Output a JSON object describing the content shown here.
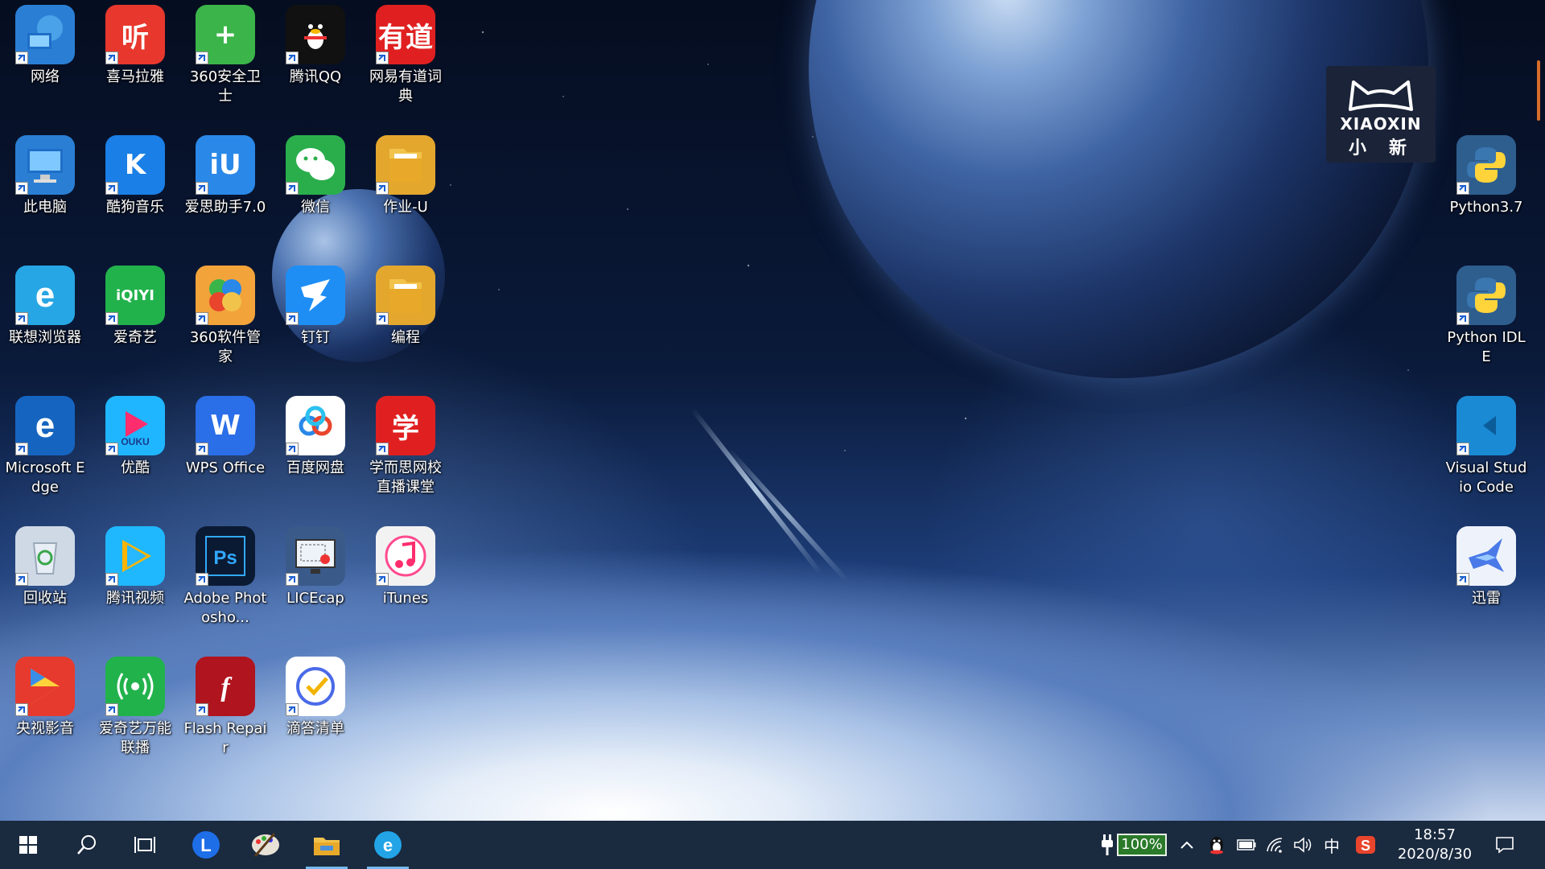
{
  "desktop": {
    "icons": [
      {
        "label": "网络",
        "color": "#2a7fd4",
        "glyph": "net"
      },
      {
        "label": "喜马拉雅",
        "color": "#e8382d",
        "glyph": "听"
      },
      {
        "label": "360安全卫士",
        "color": "#3bb54a",
        "glyph": "+"
      },
      {
        "label": "腾讯QQ",
        "color": "#111111",
        "glyph": "qq"
      },
      {
        "label": "网易有道词典",
        "color": "#e02020",
        "glyph": "有道"
      },
      {
        "label": "此电脑",
        "color": "#2a7fd4",
        "glyph": "pc"
      },
      {
        "label": "酷狗音乐",
        "color": "#1a7fe6",
        "glyph": "K"
      },
      {
        "label": "爱思助手7.0",
        "color": "#2a88e8",
        "glyph": "iU"
      },
      {
        "label": "微信",
        "color": "#2aae4c",
        "glyph": "wx"
      },
      {
        "label": "作业-U",
        "color": "#e3a72e",
        "glyph": "folder"
      },
      {
        "label": "联想浏览器",
        "color": "#26a6e4",
        "glyph": "e"
      },
      {
        "label": "爱奇艺",
        "color": "#22b24c",
        "glyph": "iQIYI"
      },
      {
        "label": "360软件管家",
        "color": "#f2a33a",
        "glyph": "flower"
      },
      {
        "label": "钉钉",
        "color": "#1e8ef5",
        "glyph": "dd"
      },
      {
        "label": "编程",
        "color": "#e3a72e",
        "glyph": "folder"
      },
      {
        "label": "Microsoft Edge",
        "color": "#1565c0",
        "glyph": "e"
      },
      {
        "label": "优酷",
        "color": "#1fb6ff",
        "glyph": "youku"
      },
      {
        "label": "WPS Office",
        "color": "#2a6ee8",
        "glyph": "W"
      },
      {
        "label": "百度网盘",
        "color": "#ffffff",
        "glyph": "bd"
      },
      {
        "label": "学而思网校直播课堂",
        "color": "#e02020",
        "glyph": "学"
      },
      {
        "label": "回收站",
        "color": "#cfd9e6",
        "glyph": "bin"
      },
      {
        "label": "腾讯视频",
        "color": "#1fb8ff",
        "glyph": "play"
      },
      {
        "label": "Adobe Photosho...",
        "color": "#0b1a33",
        "glyph": "Ps"
      },
      {
        "label": "LICEcap",
        "color": "#3a5a8a",
        "glyph": "rec"
      },
      {
        "label": "iTunes",
        "color": "#f2f2f2",
        "glyph": "note"
      },
      {
        "label": "央视影音",
        "color": "#e63a2e",
        "glyph": "cctv"
      },
      {
        "label": "爱奇艺万能联播",
        "color": "#22b24c",
        "glyph": "wave"
      },
      {
        "label": "Flash Repair",
        "color": "#b0141e",
        "glyph": "f"
      },
      {
        "label": "滴答清单",
        "color": "#ffffff",
        "glyph": "check"
      }
    ],
    "right_icons": [
      {
        "label": "Python3.7",
        "color": "#2e5e8e",
        "glyph": "py"
      },
      {
        "label": "Python IDLE",
        "color": "#2e5e8e",
        "glyph": "py"
      },
      {
        "label": "Visual Studio Code",
        "color": "#1a8ad4",
        "glyph": "vsc"
      },
      {
        "label": "迅雷",
        "color": "#eef2fb",
        "glyph": "xl"
      }
    ],
    "brand_logo": {
      "line1": "XIAOXIN",
      "line2": "小新"
    }
  },
  "taskbar": {
    "buttons": [
      {
        "name": "start-button",
        "icon": "windows-icon"
      },
      {
        "name": "search-button",
        "icon": "search-icon"
      },
      {
        "name": "task-view-button",
        "icon": "task-view-icon"
      },
      {
        "name": "taskbar-app-lenovo",
        "icon": "lenovo-icon"
      },
      {
        "name": "taskbar-app-paint",
        "icon": "paint-icon"
      },
      {
        "name": "taskbar-app-file-explorer",
        "icon": "folder-icon"
      },
      {
        "name": "taskbar-app-lenovo-browser",
        "icon": "lenovo-browser-icon"
      }
    ],
    "battery_percent": "100%",
    "ime": "中",
    "time": "18:57",
    "date": "2020/8/30"
  }
}
